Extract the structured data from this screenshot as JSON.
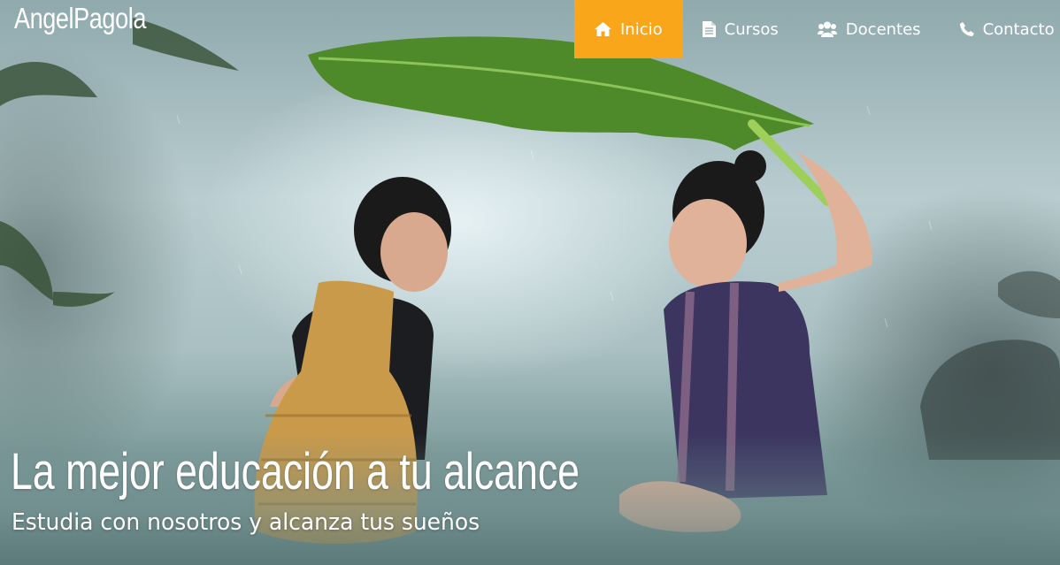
{
  "brand": {
    "name": "AngelPagola"
  },
  "nav": {
    "items": [
      {
        "label": "Inicio",
        "icon": "home-icon"
      },
      {
        "label": "Cursos",
        "icon": "file-icon"
      },
      {
        "label": "Docentes",
        "icon": "users-icon"
      },
      {
        "label": "Contacto",
        "icon": "phone-icon"
      }
    ],
    "active_index": 0
  },
  "hero": {
    "headline": "La mejor educación a tu alcance",
    "subheadline": "Estudia con nosotros y alcanza tus sueños"
  },
  "colors": {
    "accent": "#f9a61a",
    "text": "#ffffff"
  }
}
